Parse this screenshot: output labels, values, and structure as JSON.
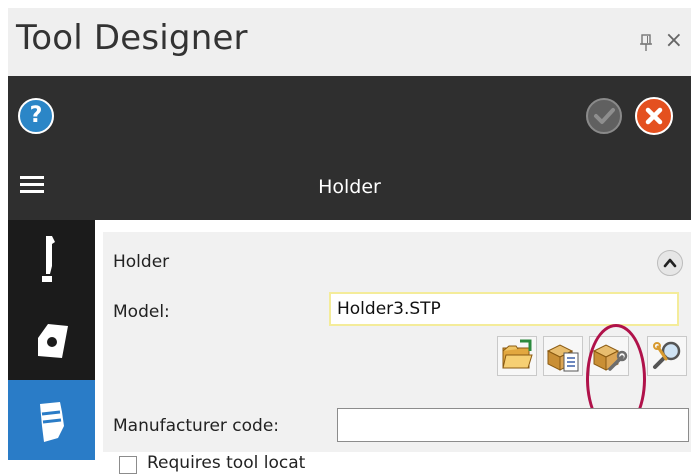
{
  "app": {
    "title": "Tool Designer",
    "pin_icon": "pin-icon",
    "close_label": "×"
  },
  "toolbar": {
    "help_label": "?",
    "help_icon": "help-icon",
    "ok_icon": "check-icon",
    "cancel_icon": "x-icon",
    "menu_icon": "hamburger-icon",
    "header_title": "Holder",
    "colors": {
      "background": "#2f2f2f",
      "help": "#2b86c7",
      "cancel": "#e4501f",
      "ok_disabled": "#606060"
    }
  },
  "nav": {
    "items": [
      {
        "id": "tool",
        "icon": "tool-shank-icon",
        "active": false
      },
      {
        "id": "insert",
        "icon": "insert-icon",
        "active": false
      },
      {
        "id": "holder",
        "icon": "holder-icon",
        "active": true
      }
    ],
    "active_color": "#2a7cc7"
  },
  "holder_group": {
    "title": "Holder",
    "collapse_icon": "chevron-up-icon",
    "model": {
      "label": "Model:",
      "value": "Holder3.STP"
    },
    "model_buttons": [
      {
        "id": "open",
        "icon": "folder-open-icon"
      },
      {
        "id": "list",
        "icon": "box-list-icon"
      },
      {
        "id": "wrench",
        "icon": "box-wrench-icon",
        "highlighted": true
      },
      {
        "id": "inspect",
        "icon": "magnifier-wrench-icon"
      }
    ],
    "highlight_color": "#b0124a",
    "manufacturer_code": {
      "label": "Manufacturer code:",
      "value": ""
    },
    "checkbox": {
      "label": "Requires tool locat",
      "checked": false
    }
  }
}
